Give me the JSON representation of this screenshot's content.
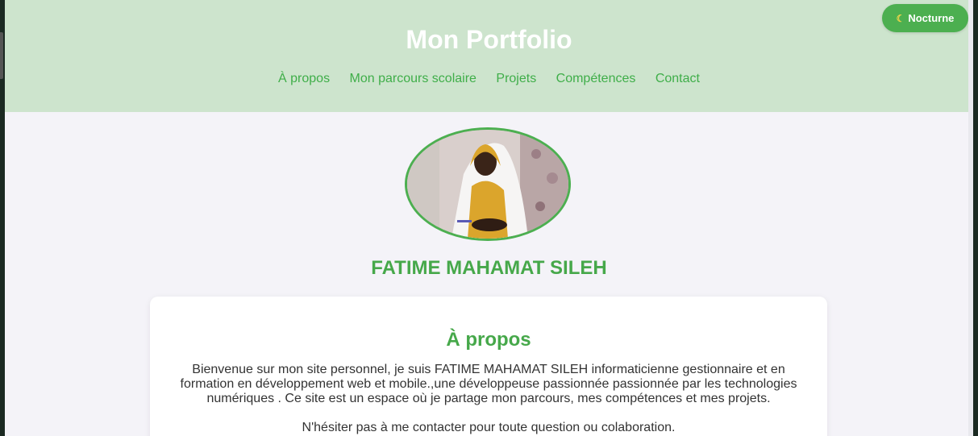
{
  "header": {
    "title": "Mon Portfolio",
    "nav": [
      {
        "label": "À propos"
      },
      {
        "label": "Mon parcours scolaire"
      },
      {
        "label": "Projets"
      },
      {
        "label": "Compétences"
      },
      {
        "label": "Contact"
      }
    ],
    "theme_toggle": {
      "icon": "moon-icon",
      "label": "Nocturne"
    }
  },
  "profile": {
    "name": "FATIME MAHAMAT SILEH"
  },
  "about": {
    "heading": "À propos",
    "paragraph1": "Bienvenue sur mon site personnel, je suis FATIME MAHAMAT SILEH informaticienne gestionnaire et en formation en développement web et mobile.,une développeuse passionnée passionnée par les technologies numériques . Ce site est un espace où je partage mon parcours, mes compétences et mes projets.",
    "paragraph2": "N'hésiter pas à me contacter pour toute question ou colaboration."
  },
  "colors": {
    "accent": "#4caf50",
    "header_bg": "#cde4cd",
    "page_bg": "#f4f3f8"
  }
}
